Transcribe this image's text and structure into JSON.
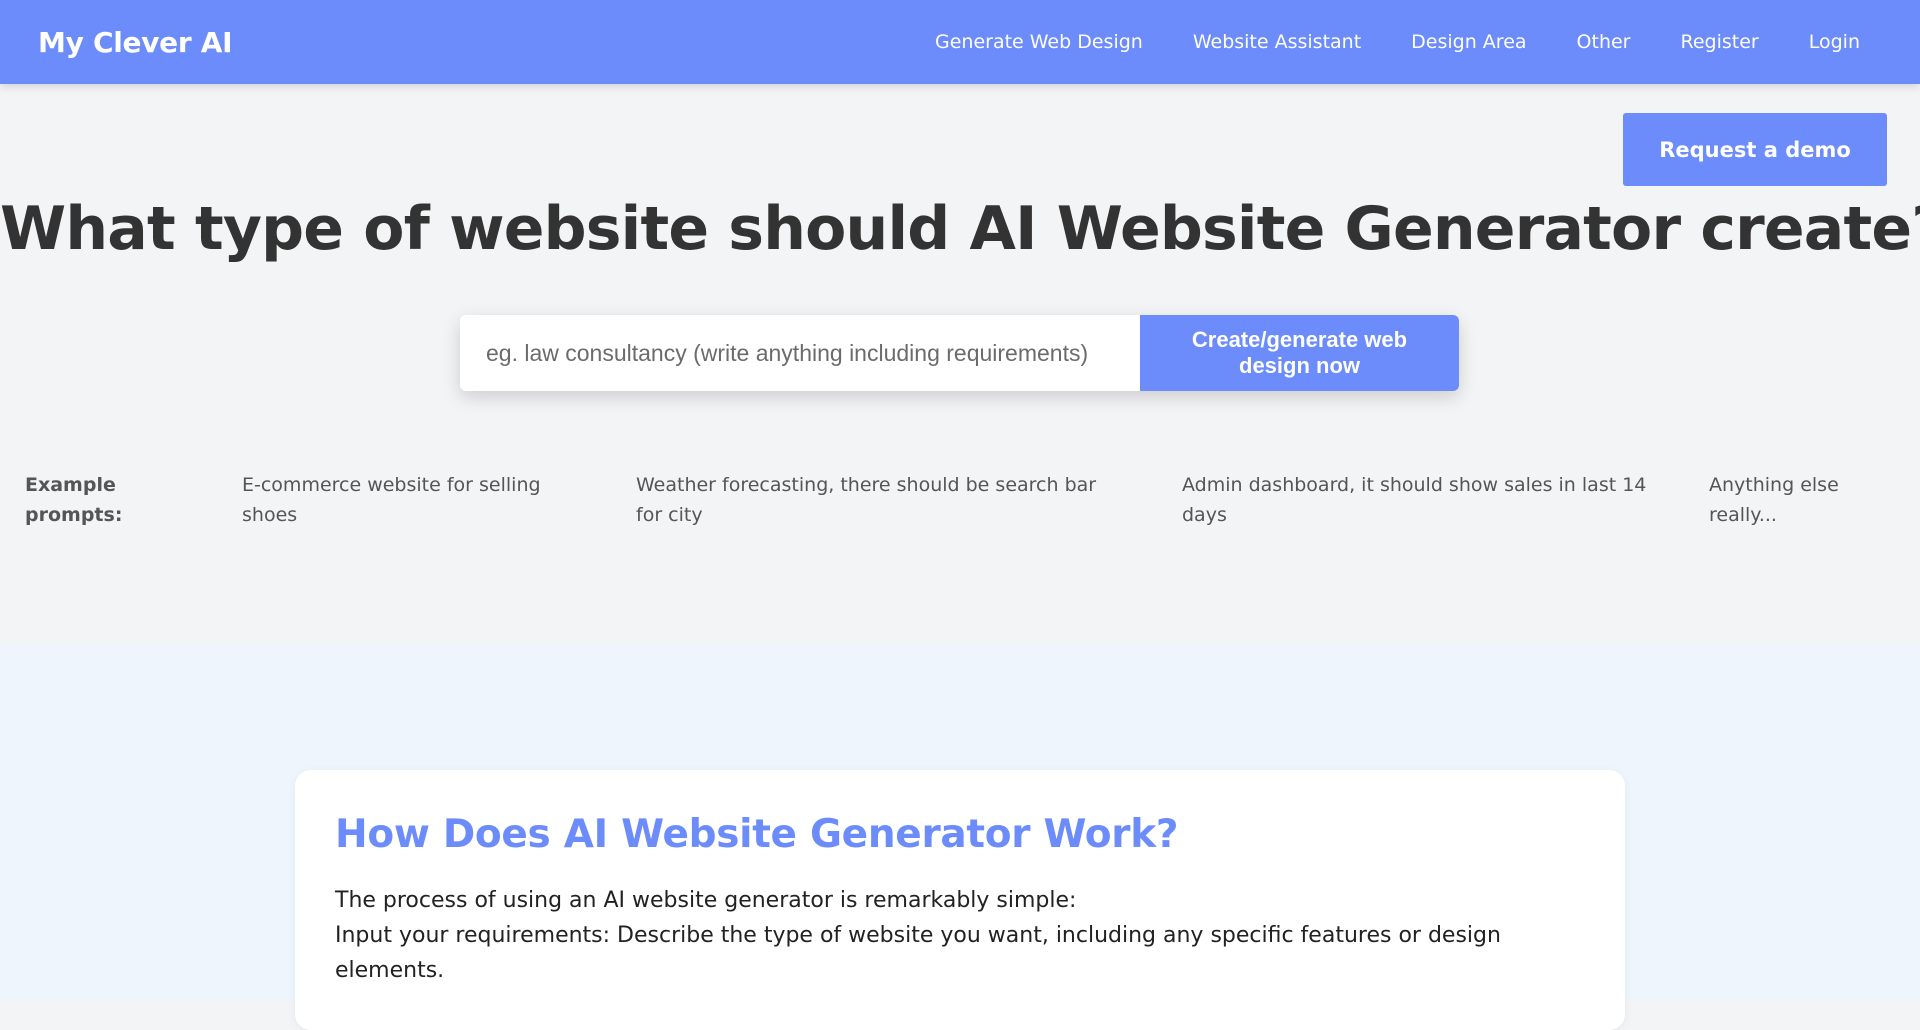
{
  "brand": "My Clever AI",
  "nav": [
    {
      "label": "Generate Web Design"
    },
    {
      "label": "Website Assistant"
    },
    {
      "label": "Design Area"
    },
    {
      "label": "Other"
    },
    {
      "label": "Register"
    },
    {
      "label": "Login"
    }
  ],
  "hero": {
    "demo_button": "Request a demo",
    "title": "What type of website should AI Website Generator create?",
    "search": {
      "value": "",
      "placeholder": "eg. law consultancy (write anything including requirements)"
    },
    "generate_button": "Create/generate web design now"
  },
  "examples": {
    "label": "Example prompts:",
    "items": [
      "E-commerce website for selling shoes",
      "Weather forecasting, there should be search bar for city",
      "Admin dashboard, it should show sales in last 14 days",
      "Anything else really..."
    ]
  },
  "how_it_works": {
    "title": "How Does AI Website Generator Work?",
    "intro": "The process of using an AI website generator is remarkably simple:",
    "step1": "Input your requirements: Describe the type of website you want, including any specific features or design elements."
  },
  "colors": {
    "accent": "#6b8cfa",
    "hero_bg": "#f3f4f6",
    "section_bg": "#eef5fd",
    "text": "#333333"
  }
}
